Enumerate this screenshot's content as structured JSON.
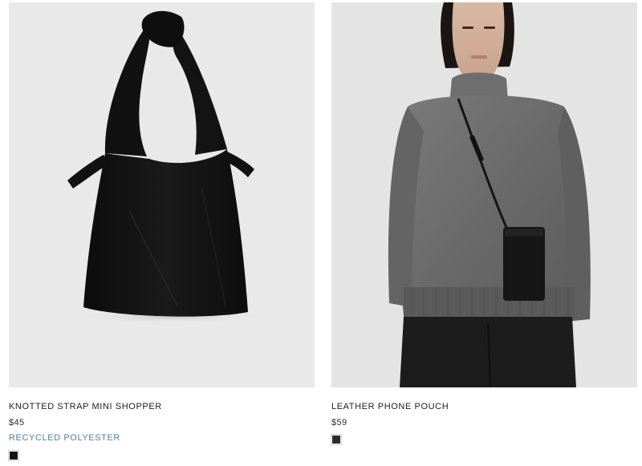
{
  "products": [
    {
      "title": "KNOTTED STRAP MINI SHOPPER",
      "price": "$45",
      "material": "RECYCLED POLYESTER",
      "swatch_color": "#141414",
      "image_icon": "black-tote-bag-image"
    },
    {
      "title": "LEATHER PHONE POUCH",
      "price": "$59",
      "swatch_color": "#2b2b2b",
      "image_icon": "model-with-phone-pouch-image"
    }
  ],
  "colors": {
    "material_accent": "#587fa0",
    "text": "#1e1e1e",
    "image_bg_left": "#e9e9e9",
    "image_bg_right": "#e4e4e4"
  }
}
